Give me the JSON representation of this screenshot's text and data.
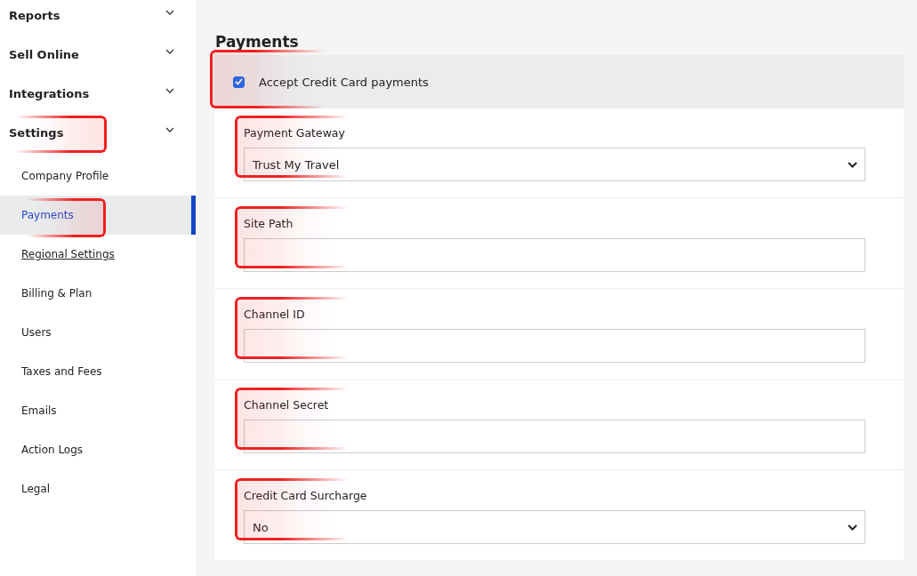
{
  "sidebar": {
    "items": [
      {
        "label": "Reports",
        "highlighted": false
      },
      {
        "label": "Sell Online",
        "highlighted": false
      },
      {
        "label": "Integrations",
        "highlighted": false
      },
      {
        "label": "Settings",
        "highlighted": true,
        "children": [
          {
            "label": "Company Profile",
            "selected": false,
            "hovered": false,
            "highlighted": false
          },
          {
            "label": "Payments",
            "selected": true,
            "hovered": false,
            "highlighted": true
          },
          {
            "label": "Regional Settings",
            "selected": false,
            "hovered": true,
            "highlighted": false
          },
          {
            "label": "Billing & Plan",
            "selected": false,
            "hovered": false,
            "highlighted": false
          },
          {
            "label": "Users",
            "selected": false,
            "hovered": false,
            "highlighted": false
          },
          {
            "label": "Taxes and Fees",
            "selected": false,
            "hovered": false,
            "highlighted": false
          },
          {
            "label": "Emails",
            "selected": false,
            "hovered": false,
            "highlighted": false
          },
          {
            "label": "Action Logs",
            "selected": false,
            "hovered": false,
            "highlighted": false
          },
          {
            "label": "Legal",
            "selected": false,
            "hovered": false,
            "highlighted": false
          }
        ]
      }
    ]
  },
  "page": {
    "title": "Payments"
  },
  "accept_card": {
    "label": "Accept Credit Card payments",
    "checked": true,
    "highlighted": true
  },
  "fields": [
    {
      "label": "Payment Gateway",
      "kind": "select",
      "value": "Trust My Travel",
      "highlighted": true
    },
    {
      "label": "Site Path",
      "kind": "text",
      "highlighted": true
    },
    {
      "label": "Channel ID",
      "kind": "text",
      "highlighted": true
    },
    {
      "label": "Channel Secret",
      "kind": "text",
      "highlighted": true
    },
    {
      "label": "Credit Card Surcharge",
      "kind": "select",
      "value": "No",
      "highlighted": true
    }
  ]
}
